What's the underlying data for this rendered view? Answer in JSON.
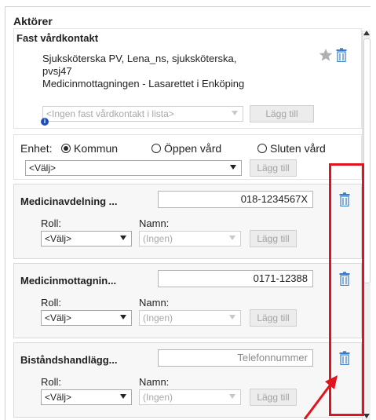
{
  "panel": {
    "title": "Aktörer"
  },
  "fast_vardkontakt": {
    "heading": "Fast vårdkontakt",
    "line1": "Sjuksköterska PV, Lena_ns, sjuksköterska,",
    "line2": "pvsj47",
    "line3": "Medicinmottagningen - Lasarettet i Enköping",
    "select_placeholder": "<Ingen fast vårdkontakt i lista>",
    "add_label": "Lägg till",
    "star_icon": "star-icon",
    "trash_icon": "trash-icon",
    "info_icon": "info-icon"
  },
  "enhet": {
    "label": "Enhet:",
    "options": [
      "Kommun",
      "Öppen vård",
      "Sluten vård"
    ],
    "selected": "Kommun",
    "select_value": "<Välj>",
    "add_label": "Lägg till"
  },
  "actors": [
    {
      "name": "Medicinavdelning ...",
      "phone": "018-1234567X",
      "phone_placeholder": "",
      "roll_label": "Roll:",
      "namn_label": "Namn:",
      "roll_value": "<Välj>",
      "namn_value": "(Ingen)",
      "add_label": "Lägg till"
    },
    {
      "name": "Medicinmottagnin...",
      "phone": "0171-12388",
      "phone_placeholder": "",
      "roll_label": "Roll:",
      "namn_label": "Namn:",
      "roll_value": "<Välj>",
      "namn_value": "(Ingen)",
      "add_label": "Lägg till"
    },
    {
      "name": "Biståndshandlägg...",
      "phone": "",
      "phone_placeholder": "Telefonnummer",
      "roll_label": "Roll:",
      "namn_label": "Namn:",
      "roll_value": "<Välj>",
      "namn_value": "(Ingen)",
      "add_label": "Lägg till"
    }
  ],
  "colors": {
    "annotation_red": "#e0141e",
    "trash_blue": "#3a7fc4",
    "star_gray": "#b0b0b0"
  }
}
